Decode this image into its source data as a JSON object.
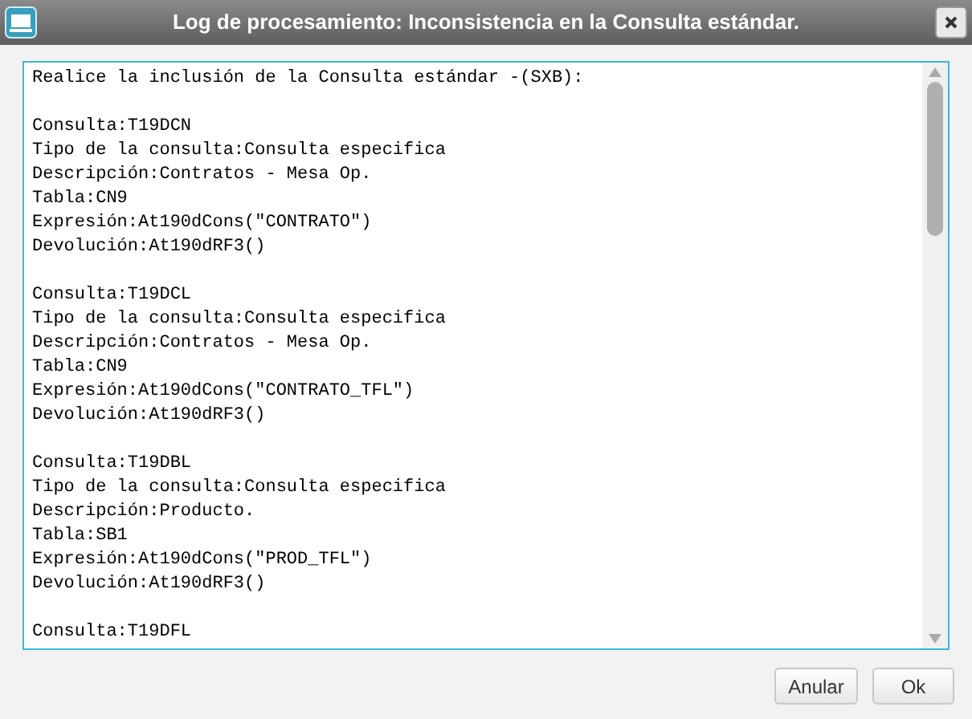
{
  "window": {
    "title": "Log de procesamiento:  Inconsistencia en la Consulta estándar."
  },
  "log": {
    "intro": "Realice la inclusión de la Consulta estándar -(SXB):",
    "blocks": [
      {
        "lines": [
          "Consulta:T19DCN",
          "Tipo de la consulta:Consulta especifica",
          "Descripción:Contratos - Mesa Op.",
          "Tabla:CN9",
          "Expresión:At190dCons(\"CONTRATO\")",
          "Devolución:At190dRF3()"
        ]
      },
      {
        "lines": [
          "Consulta:T19DCL",
          "Tipo de la consulta:Consulta especifica",
          "Descripción:Contratos - Mesa Op.",
          "Tabla:CN9",
          "Expresión:At190dCons(\"CONTRATO_TFL\")",
          "Devolución:At190dRF3()"
        ]
      },
      {
        "lines": [
          "Consulta:T19DBL",
          "Tipo de la consulta:Consulta especifica",
          "Descripción:Producto.",
          "Tabla:SB1",
          "Expresión:At190dCons(\"PROD_TFL\")",
          "Devolución:At190dRF3()"
        ]
      },
      {
        "lines": [
          "Consulta:T19DFL"
        ]
      }
    ]
  },
  "buttons": [
    "Anular",
    "Ok"
  ]
}
